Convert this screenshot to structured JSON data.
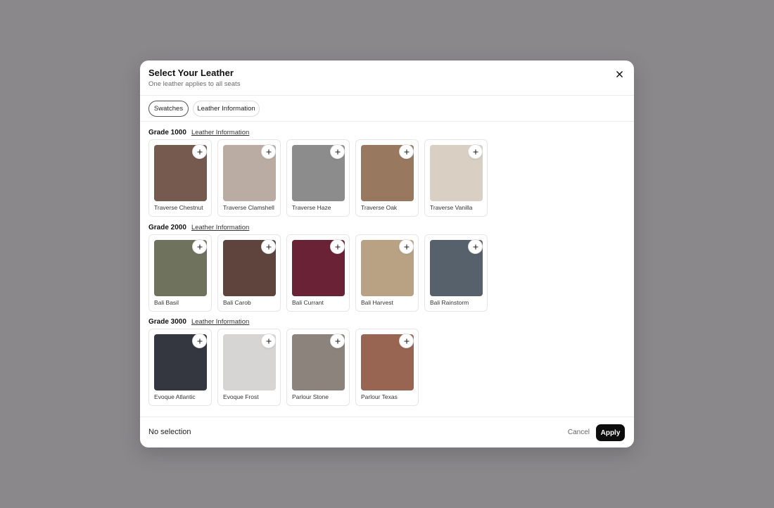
{
  "modal": {
    "title": "Select Your Leather",
    "subtitle": "One leather applies to all seats"
  },
  "tabs": [
    {
      "label": "Swatches",
      "active": true
    },
    {
      "label": "Leather Information",
      "active": false
    }
  ],
  "grades": [
    {
      "title": "Grade 1000",
      "link": "Leather Information",
      "swatches": [
        {
          "name": "Traverse Chestnut",
          "color": "#76594f"
        },
        {
          "name": "Traverse Clamshell",
          "color": "#bbaca3"
        },
        {
          "name": "Traverse Haze",
          "color": "#8c8c8c"
        },
        {
          "name": "Traverse Oak",
          "color": "#98785f"
        },
        {
          "name": "Traverse Vanilla",
          "color": "#d9cfc2"
        }
      ]
    },
    {
      "title": "Grade 2000",
      "link": "Leather Information",
      "swatches": [
        {
          "name": "Bali Basil",
          "color": "#6f735d"
        },
        {
          "name": "Bali Carob",
          "color": "#5e443c"
        },
        {
          "name": "Bali Currant",
          "color": "#6a2336"
        },
        {
          "name": "Bali Harvest",
          "color": "#b8a283"
        },
        {
          "name": "Bali Rainstorm",
          "color": "#57616b"
        }
      ]
    },
    {
      "title": "Grade 3000",
      "link": "Leather Information",
      "swatches": [
        {
          "name": "Evoque Atlantic",
          "color": "#34373f"
        },
        {
          "name": "Evoque Frost",
          "color": "#d7d5d3"
        },
        {
          "name": "Parlour Stone",
          "color": "#8c837c"
        },
        {
          "name": "Parlour Texas",
          "color": "#996553"
        }
      ]
    }
  ],
  "icons": {
    "close": "close-icon",
    "add": "plus-icon"
  },
  "footer": {
    "selection_status": "No selection",
    "cancel_label": "Cancel",
    "apply_label": "Apply"
  }
}
